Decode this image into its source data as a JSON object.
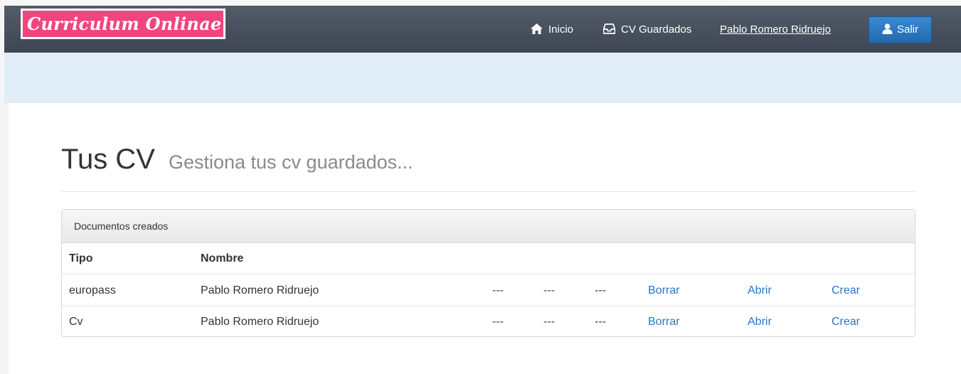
{
  "app": {
    "logo_text": "Curriculum Onlinae"
  },
  "nav": {
    "inicio": "Inicio",
    "cv_guardados": "CV Guardados",
    "user": "Pablo  Romero Ridruejo",
    "salir": "Salir"
  },
  "icons": {
    "inicio": "home-icon",
    "cv_guardados": "inbox-icon",
    "salir": "user-icon"
  },
  "colors": {
    "logo_bg": "#f0457e",
    "navbar": "#3d4652",
    "button": "#2368ad",
    "link": "#2a74c8",
    "band": "#e1eef7"
  },
  "page": {
    "title": "Tus CV",
    "subtitle": "Gestiona tus cv guardados..."
  },
  "panel": {
    "heading": "Documentos creados",
    "columns": [
      "Tipo",
      "Nombre"
    ],
    "rows": [
      {
        "tipo": "europass",
        "nombre": "Pablo Romero Ridruejo",
        "c1": "---",
        "c2": "---",
        "c3": "---",
        "borrar": "Borrar",
        "abrir": "Abrir",
        "crear": "Crear"
      },
      {
        "tipo": "Cv",
        "nombre": "Pablo Romero Ridruejo",
        "c1": "---",
        "c2": "---",
        "c3": "---",
        "borrar": "Borrar",
        "abrir": "Abrir",
        "crear": "Crear"
      }
    ]
  }
}
